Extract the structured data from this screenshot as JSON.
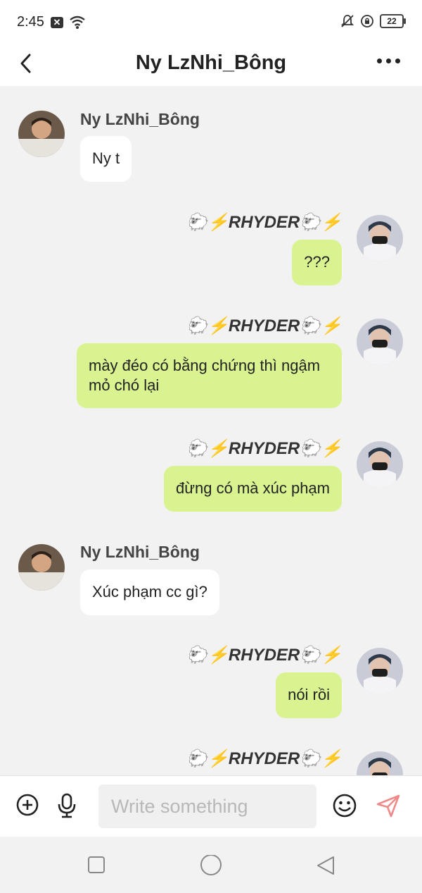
{
  "status": {
    "time": "2:45",
    "battery": "22"
  },
  "header": {
    "title": "Ny LzNhi_Bông"
  },
  "messages": [
    {
      "sender": "Ny LzNhi_Bông",
      "text": "Ny t"
    },
    {
      "sender": "🐑⚡RHYDER🐑⚡",
      "text": "???"
    },
    {
      "sender": "🐑⚡RHYDER🐑⚡",
      "text": "mày đéo có bằng chứng thì ngậm mỏ chó lại"
    },
    {
      "sender": "🐑⚡RHYDER🐑⚡",
      "text": "đừng có mà xúc phạm"
    },
    {
      "sender": "Ny LzNhi_Bông",
      "text": "Xúc phạm cc gì?"
    },
    {
      "sender": "🐑⚡RHYDER🐑⚡",
      "text": "nói rồi"
    },
    {
      "sender": "🐑⚡RHYDER🐑⚡",
      "text": ""
    }
  ],
  "composer": {
    "placeholder": "Write something"
  },
  "colors": {
    "outgoing_bubble": "#d9f391",
    "incoming_bubble": "#ffffff",
    "send_icon": "#f08a8a"
  },
  "icons": [
    "back-arrow-icon",
    "more-dots-icon",
    "add-icon",
    "microphone-icon",
    "emoji-icon",
    "send-icon",
    "nav-recent-icon",
    "nav-home-icon",
    "nav-back-icon"
  ]
}
